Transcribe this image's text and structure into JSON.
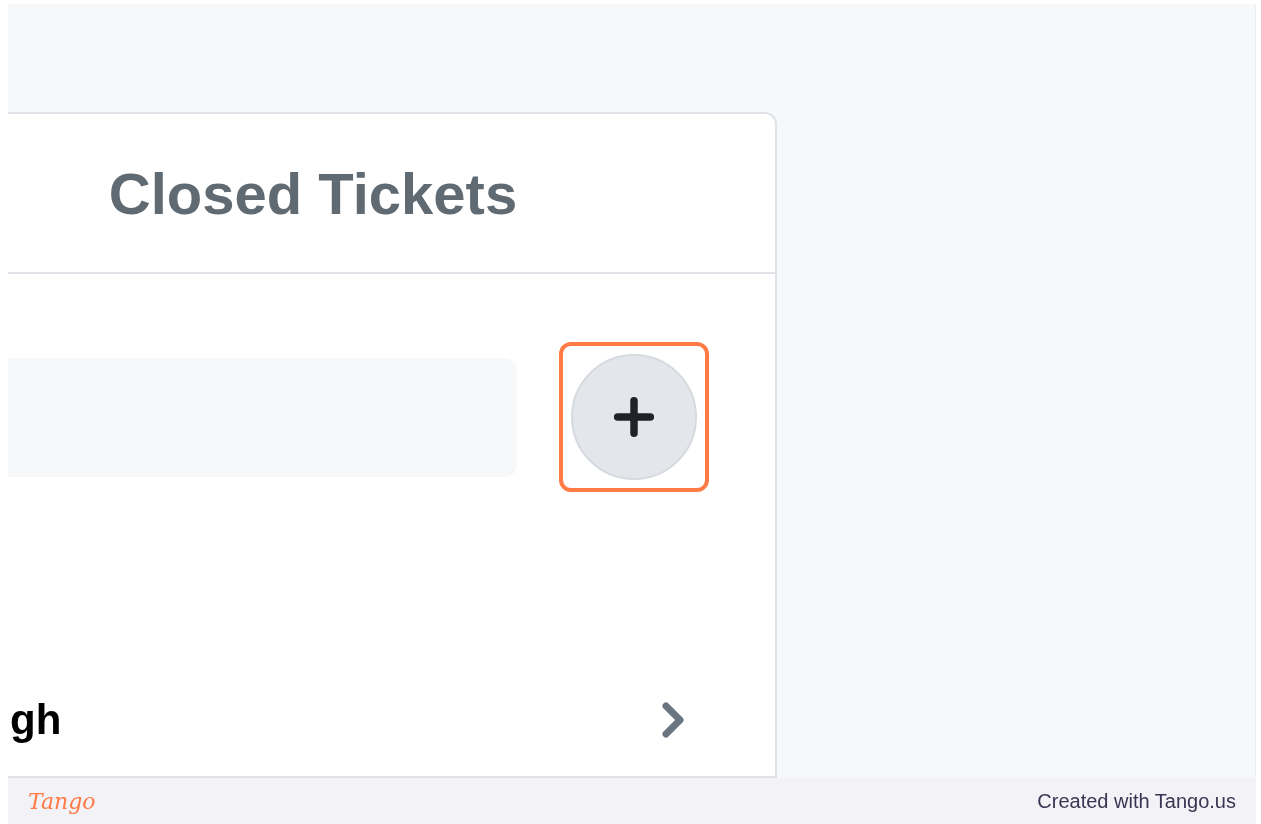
{
  "card": {
    "title": "Closed Tickets"
  },
  "add_button": {
    "highlighted": true
  },
  "list_row": {
    "label": "gh"
  },
  "footer": {
    "logo": "Tango",
    "credit": "Created with Tango.us"
  }
}
